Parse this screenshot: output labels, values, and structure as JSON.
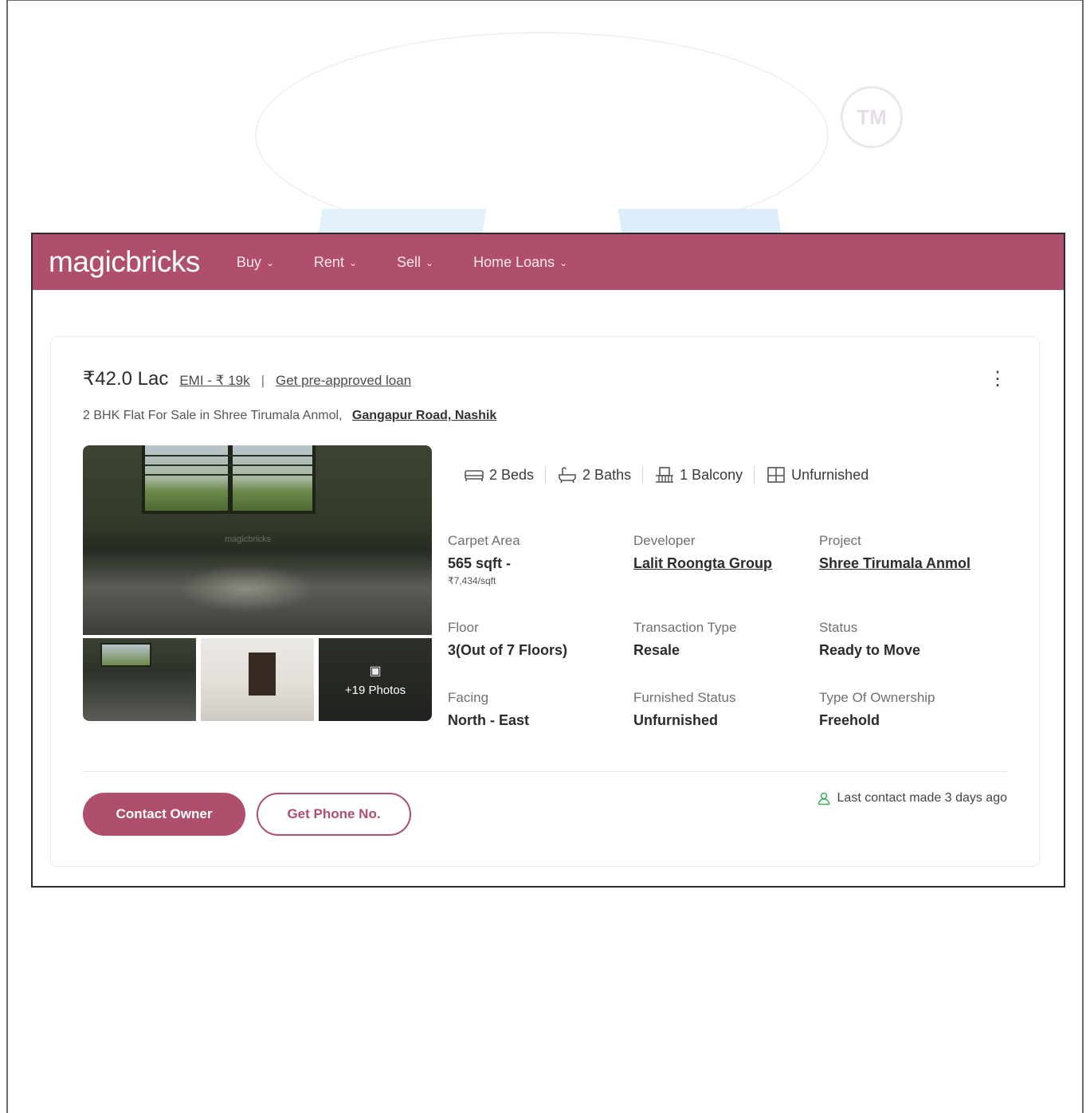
{
  "brand": {
    "name": "magicbricks",
    "color": "#b04f6b"
  },
  "background": {
    "tm_mark": "TM"
  },
  "nav": {
    "items": [
      {
        "label": "Buy"
      },
      {
        "label": "Rent"
      },
      {
        "label": "Sell"
      },
      {
        "label": "Home Loans"
      }
    ],
    "chevron_icon": "chevron-down-icon"
  },
  "listing": {
    "price": "₹42.0 Lac",
    "emi": "EMI - ₹ 19k",
    "separator": "|",
    "loan_link": "Get pre-approved loan",
    "title": "2 BHK Flat For Sale in Shree Tirumala Anmol,",
    "location": "Gangapur Road, Nashik",
    "more_icon": "kebab-menu-icon",
    "gallery": {
      "more_photos": "+19 Photos",
      "watermark": "magicbricks"
    },
    "features": [
      {
        "icon": "bed-icon",
        "label": "2 Beds"
      },
      {
        "icon": "bath-icon",
        "label": "2 Baths"
      },
      {
        "icon": "balcony-icon",
        "label": "1 Balcony"
      },
      {
        "icon": "furnishing-icon",
        "label": "Unfurnished"
      }
    ],
    "details": {
      "carpet_area": {
        "label": "Carpet Area",
        "value": "565 sqft -",
        "sub": "₹7,434/sqft"
      },
      "developer": {
        "label": "Developer",
        "value": "Lalit Roongta Group"
      },
      "project": {
        "label": "Project",
        "value": "Shree Tirumala Anmol"
      },
      "floor": {
        "label": "Floor",
        "value": "3(Out of 7 Floors)"
      },
      "transaction": {
        "label": "Transaction Type",
        "value": "Resale"
      },
      "status": {
        "label": "Status",
        "value": "Ready to Move"
      },
      "facing": {
        "label": "Facing",
        "value": "North - East"
      },
      "furnished": {
        "label": "Furnished Status",
        "value": "Unfurnished"
      },
      "ownership": {
        "label": "Type Of Ownership",
        "value": "Freehold"
      }
    },
    "actions": {
      "contact": "Contact Owner",
      "phone": "Get Phone No."
    },
    "last_contact": "Last contact made 3 days ago"
  }
}
